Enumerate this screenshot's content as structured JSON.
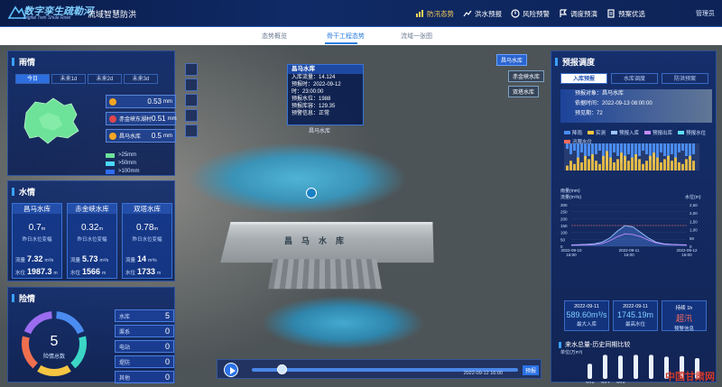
{
  "header": {
    "brand": "数字孪生疏勒河",
    "brand_sub": "Digital Twin Shule River",
    "app_title": "流域智慧防洪",
    "nav": [
      {
        "label": "防汛态势",
        "active": true
      },
      {
        "label": "洪水预报",
        "active": false
      },
      {
        "label": "风险预警",
        "active": false
      },
      {
        "label": "调度预演",
        "active": false
      },
      {
        "label": "预案优选",
        "active": false
      }
    ],
    "user": "管理员"
  },
  "subnav": {
    "tabs": [
      "态势概览",
      "骨干工程态势",
      "流域一张图"
    ],
    "active_index": 1
  },
  "rain": {
    "title": "雨情",
    "tabs": [
      "今日",
      "未来1d",
      "未来2d",
      "未来3d"
    ],
    "stations": [
      {
        "name": "",
        "value": "0.53",
        "unit": "mm"
      },
      {
        "name": "赤金峡东湖村",
        "value": "0.51",
        "unit": "mm"
      },
      {
        "name": "昌马水库",
        "value": "0.5",
        "unit": "mm"
      }
    ],
    "legend": [
      {
        "label": ">25mm",
        "color": "#6de39a"
      },
      {
        "label": ">50mm",
        "color": "#4ad8ff"
      },
      {
        "label": ">100mm",
        "color": "#2f6cf0"
      }
    ]
  },
  "water": {
    "title": "水情",
    "reservoirs": [
      {
        "name": "昌马水库",
        "change": "0.7",
        "change_unit": "m",
        "caption": "昨日水位变幅",
        "flow_label": "流量",
        "flow": "7.32",
        "flow_unit": "m³/s",
        "level_label": "水位",
        "level": "1987.3",
        "level_unit": "m"
      },
      {
        "name": "赤金峡水库",
        "change": "0.32",
        "change_unit": "m",
        "caption": "昨日水位变幅",
        "flow_label": "流量",
        "flow": "5.73",
        "flow_unit": "m³/s",
        "level_label": "水位",
        "level": "1566",
        "level_unit": "m"
      },
      {
        "name": "双塔水库",
        "change": "0.78",
        "change_unit": "m",
        "caption": "昨日水位变幅",
        "flow_label": "流量",
        "flow": "14",
        "flow_unit": "m³/s",
        "level_label": "水位",
        "level": "1733",
        "level_unit": "m"
      }
    ]
  },
  "danger": {
    "title": "险情",
    "total": "5",
    "total_label": "险情总数",
    "items": [
      {
        "label": "水库",
        "value": "5"
      },
      {
        "label": "渠系",
        "value": "0"
      },
      {
        "label": "电站",
        "value": "0"
      },
      {
        "label": "堤防",
        "value": "0"
      },
      {
        "label": "其他",
        "value": "0"
      }
    ],
    "colors": [
      "#4a8cf0",
      "#3bd6c6",
      "#f5c542",
      "#ef6f4f",
      "#9c6cf0"
    ]
  },
  "popup": {
    "title": "昌马水库",
    "rows": [
      "入库流量：14.124",
      "预报时：2022-09-12",
      "时：23:00:00",
      "预报水位：1988",
      "预报库容：129.35",
      "预警信息：正常"
    ]
  },
  "scene": {
    "tags": [
      "昌马水库",
      "赤金峡水库",
      "双塔水库"
    ],
    "marker_label": "昌马水库",
    "dam_text": "昌马水库"
  },
  "forecast": {
    "title": "预报调度",
    "tabs": [
      "入库预报",
      "水库调度",
      "防洪预案"
    ],
    "info": [
      "预报对象：昌马水库",
      "依据时间：2022-09-13 08:00:00",
      "预见期：72"
    ],
    "legend": [
      "降雨",
      "实测",
      "预报入库",
      "预报出库",
      "预报水位",
      "汛限水位"
    ],
    "y1_label": "雨量(mm)",
    "y1b_label": "流量(m³/s)",
    "y2_label": "水位(m)",
    "y_ticks_left": [
      "300",
      "250",
      "200",
      "150",
      "100",
      "50",
      "0"
    ],
    "y_ticks_right": [
      "2,50",
      "2,00",
      "1,50",
      "1,00",
      "50",
      "0"
    ],
    "x_ticks": [
      "2022-09-10\n16:00",
      "2022-09-11\n16:00",
      "2022-09-12\n16:00"
    ],
    "cards": [
      {
        "date": "2022-09-11",
        "value": "589.60m³/s",
        "caption": "最大入库",
        "red": false
      },
      {
        "date": "2022-09-11",
        "value": "1745.19m",
        "caption": "最高水位",
        "red": false
      },
      {
        "date": "持续 1h",
        "value": "超汛",
        "caption": "预警信息",
        "red": true
      }
    ],
    "compare_title": "来水总量-历史同期比较",
    "compare_unit": "单位(万m³)",
    "compare_values": [
      60,
      95,
      92,
      95,
      95,
      88,
      90,
      82
    ],
    "compare_years": [
      "2016",
      "2017",
      "2018",
      "",
      "",
      "",
      "",
      ""
    ]
  },
  "timeline": {
    "label": "预报",
    "date": "2022-09-12 16:00"
  },
  "watermark": "中国甘肃网"
}
